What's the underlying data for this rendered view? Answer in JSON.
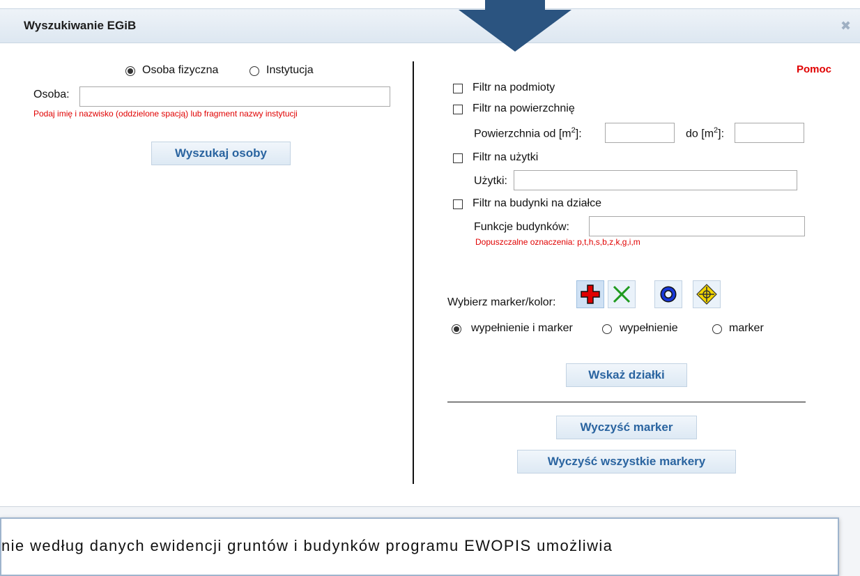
{
  "dialog": {
    "title": "Wyszukiwanie EGiB",
    "close_symbol": "✖"
  },
  "left": {
    "radio_person": "Osoba fizyczna",
    "radio_institution": "Instytucja",
    "person_label": "Osoba:",
    "person_value": "",
    "person_hint": "Podaj imię i nazwisko (oddzielone spacją) lub fragment nazwy instytucji",
    "search_button": "Wyszukaj osoby"
  },
  "right": {
    "help_link": "Pomoc",
    "filter_subjects": "Filtr na podmioty",
    "filter_area": "Filtr na powierzchnię",
    "area_from_label": "Powierzchnia od [m",
    "area_to_label": "do [m",
    "unit_sup": "2",
    "unit_close": "]:",
    "filter_landuse": "Filtr na użytki",
    "landuse_label": "Użytki:",
    "filter_buildings": "Filtr na budynki na działce",
    "buildings_label": "Funkcje budynków:",
    "buildings_hint": "Dopuszczalne oznaczenia: p,t,h,s,b,z,k,g,i,m",
    "marker_label": "Wybierz marker/kolor:",
    "markers": [
      "red-cross-marker-icon",
      "green-x-marker-icon",
      "blue-ring-marker-icon",
      "yellow-crosshair-marker-icon"
    ],
    "mode_fill_marker": "wypełnienie i marker",
    "mode_fill": "wypełnienie",
    "mode_marker": "marker",
    "show_button": "Wskaż działki",
    "clear_button": "Wyczyść marker",
    "clear_all_button": "Wyczyść wszystkie markery"
  },
  "bottom": {
    "text_fragment": "nie według danych ewidencji gruntów i budynków programu EWOPIS umożliwia"
  },
  "colors": {
    "accent": "#2a64a0",
    "hint_red": "#e00000",
    "arrow": "#2b5480"
  }
}
